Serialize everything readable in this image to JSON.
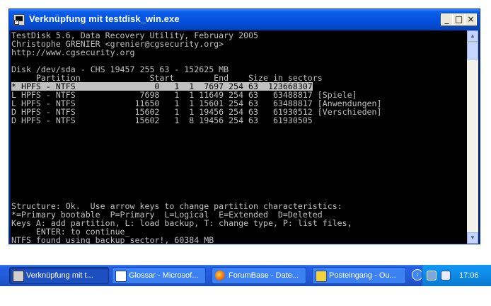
{
  "window": {
    "title": "Verknüpfung mit testdisk_win.exe",
    "minimize_glyph": "_",
    "maximize_glyph": "□",
    "close_glyph": "×"
  },
  "console": {
    "header": [
      "TestDisk 5.6, Data Recovery Utility, February 2005",
      "Christophe GRENIER <grenier@cgsecurity.org>",
      "http://www.cgsecurity.org"
    ],
    "disk_line": "Disk /dev/sda - CHS 19457 255 63 - 152625 MB",
    "column_header": "     Partition              Start        End    Size in sectors",
    "rows": [
      "* HPFS - NTFS                0   1  1  7697 254 63  123668307",
      "L HPFS - NTFS             7698   1  1 11649 254 63   63488817 [Spiele]",
      "L HPFS - NTFS            11650   1  1 15601 254 63   63488817 [Anwendungen]",
      "D HPFS - NTFS            15602   1  1 19456 254 63   61930512 [Verschieden]",
      "D HPFS - NTFS            15602   1  8 19456 254 63   61930505"
    ],
    "footer": [
      "Structure: Ok.  Use arrow keys to change partition characteristics:",
      "*=Primary bootable  P=Primary  L=Logical  E=Extended  D=Deleted",
      "Keys A: add partition, L: load backup, T: change type, P: list files,",
      "     ENTER: to continue_",
      "NTFS found using backup sector!, 60384 MB"
    ]
  },
  "taskbar": {
    "tasks": [
      {
        "label": "Verknüpfung mit t...",
        "icon": "console-icon"
      },
      {
        "label": "Glossar - Microsof...",
        "icon": "word-icon"
      },
      {
        "label": "ForumBase - Date...",
        "icon": "firefox-icon"
      },
      {
        "label": "Posteingang - Ou...",
        "icon": "outlook-icon"
      }
    ],
    "clock": "17:06"
  },
  "colors": {
    "title_bar": "#0553e0",
    "console_bg": "#000000",
    "console_text": "#c0c0c0",
    "taskbar": "#245ddc",
    "tray": "#0d8ae6"
  }
}
